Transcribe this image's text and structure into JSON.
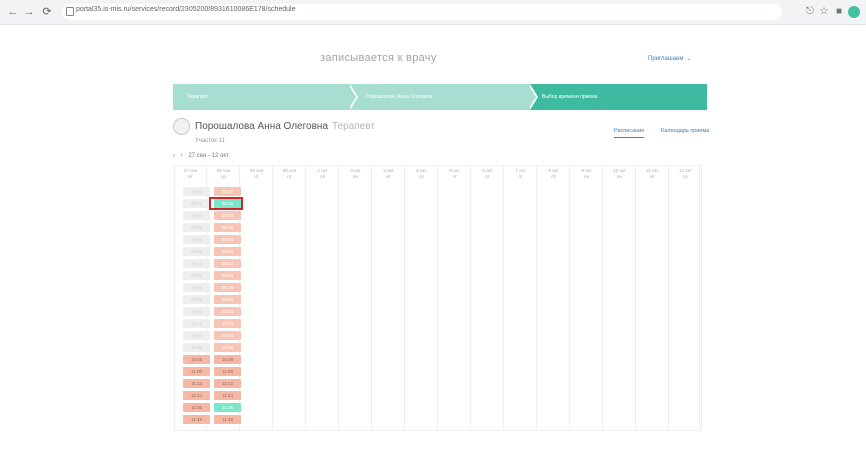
{
  "browser": {
    "url": "portal35.is-mis.ru/services/record/2305200/8931610086E178/schedule",
    "back_icon": "arrow-left-icon",
    "forward_icon": "arrow-right-icon",
    "reload_icon": "reload-icon"
  },
  "page": {
    "title": "записывается к врачу",
    "help_label": "Приглашаем"
  },
  "steps": [
    {
      "label": "Терапевт"
    },
    {
      "label": "Порошалова Анна Олеговна"
    },
    {
      "label": "Выбор времени приема"
    }
  ],
  "doctor": {
    "name": "Порошалова Анна Олеговна",
    "specialty": "Терапевт",
    "section": "Участок 11"
  },
  "view_tabs": [
    "Расписание",
    "Календарь приема"
  ],
  "date_range": "27 сен - 12 окт",
  "days": [
    {
      "date": "27 сен",
      "dow": "вт"
    },
    {
      "date": "28 сен",
      "dow": "ср"
    },
    {
      "date": "29 сен",
      "dow": "чт"
    },
    {
      "date": "30 сен",
      "dow": "пт"
    },
    {
      "date": "1 окт",
      "dow": "сб"
    },
    {
      "date": "4 окт",
      "dow": "пн"
    },
    {
      "date": "5 окт",
      "dow": "вт"
    },
    {
      "date": "6 окт",
      "dow": "ср"
    },
    {
      "date": "6 окт",
      "dow": "чт"
    },
    {
      "date": "6 окт",
      "dow": "пт"
    },
    {
      "date": "7 окт",
      "dow": "пт"
    },
    {
      "date": "8 окт",
      "dow": "сб"
    },
    {
      "date": "9 окт",
      "dow": "пн"
    },
    {
      "date": "10 окт",
      "dow": "пн"
    },
    {
      "date": "11 окт",
      "dow": "вт"
    },
    {
      "date": "12 окт",
      "dow": "ср"
    }
  ],
  "col1_slots": [
    {
      "time": "08:00",
      "state": "gray"
    },
    {
      "time": "08:12",
      "state": "gray"
    },
    {
      "time": "08:24",
      "state": "gray"
    },
    {
      "time": "08:36",
      "state": "gray"
    },
    {
      "time": "08:48",
      "state": "gray"
    },
    {
      "time": "09:00",
      "state": "gray"
    },
    {
      "time": "09:12",
      "state": "gray"
    },
    {
      "time": "09:24",
      "state": "gray"
    },
    {
      "time": "09:36",
      "state": "gray"
    },
    {
      "time": "09:48",
      "state": "gray"
    },
    {
      "time": "10:00",
      "state": "gray"
    },
    {
      "time": "10:12",
      "state": "gray"
    },
    {
      "time": "10:24",
      "state": "gray"
    },
    {
      "time": "10:36",
      "state": "gray"
    },
    {
      "time": "10:48",
      "state": "pinkdark"
    },
    {
      "time": "11:00",
      "state": "pinkdark"
    },
    {
      "time": "11:12",
      "state": "pinkdark"
    },
    {
      "time": "11:24",
      "state": "pinkdark"
    },
    {
      "time": "11:36",
      "state": "pinkdark"
    },
    {
      "time": "11:48",
      "state": "pinkdark"
    }
  ],
  "col2_slots": [
    {
      "time": "08:00",
      "state": "pink"
    },
    {
      "time": "08:12",
      "state": "mint"
    },
    {
      "time": "08:24",
      "state": "pink"
    },
    {
      "time": "08:36",
      "state": "pink"
    },
    {
      "time": "08:48",
      "state": "pink"
    },
    {
      "time": "09:00",
      "state": "pink"
    },
    {
      "time": "09:12",
      "state": "pink"
    },
    {
      "time": "09:24",
      "state": "pink"
    },
    {
      "time": "09:36",
      "state": "pink"
    },
    {
      "time": "09:48",
      "state": "pink"
    },
    {
      "time": "10:00",
      "state": "pink"
    },
    {
      "time": "10:12",
      "state": "pink"
    },
    {
      "time": "10:24",
      "state": "pink"
    },
    {
      "time": "10:36",
      "state": "pink"
    },
    {
      "time": "10:48",
      "state": "pinkdark"
    },
    {
      "time": "11:00",
      "state": "pinkdark"
    },
    {
      "time": "11:12",
      "state": "pinkdark"
    },
    {
      "time": "11:24",
      "state": "pinkdark"
    },
    {
      "time": "11:36",
      "state": "mint"
    },
    {
      "time": "11:48",
      "state": "pinkdark"
    }
  ],
  "colors": {
    "accent": "#3ebaa0",
    "steps_light": "#a8ddd1",
    "slot_busy": "#f8c4b4",
    "slot_free": "#79e7c8",
    "selected_outline": "#d0262d",
    "link": "#3a7fb5"
  }
}
